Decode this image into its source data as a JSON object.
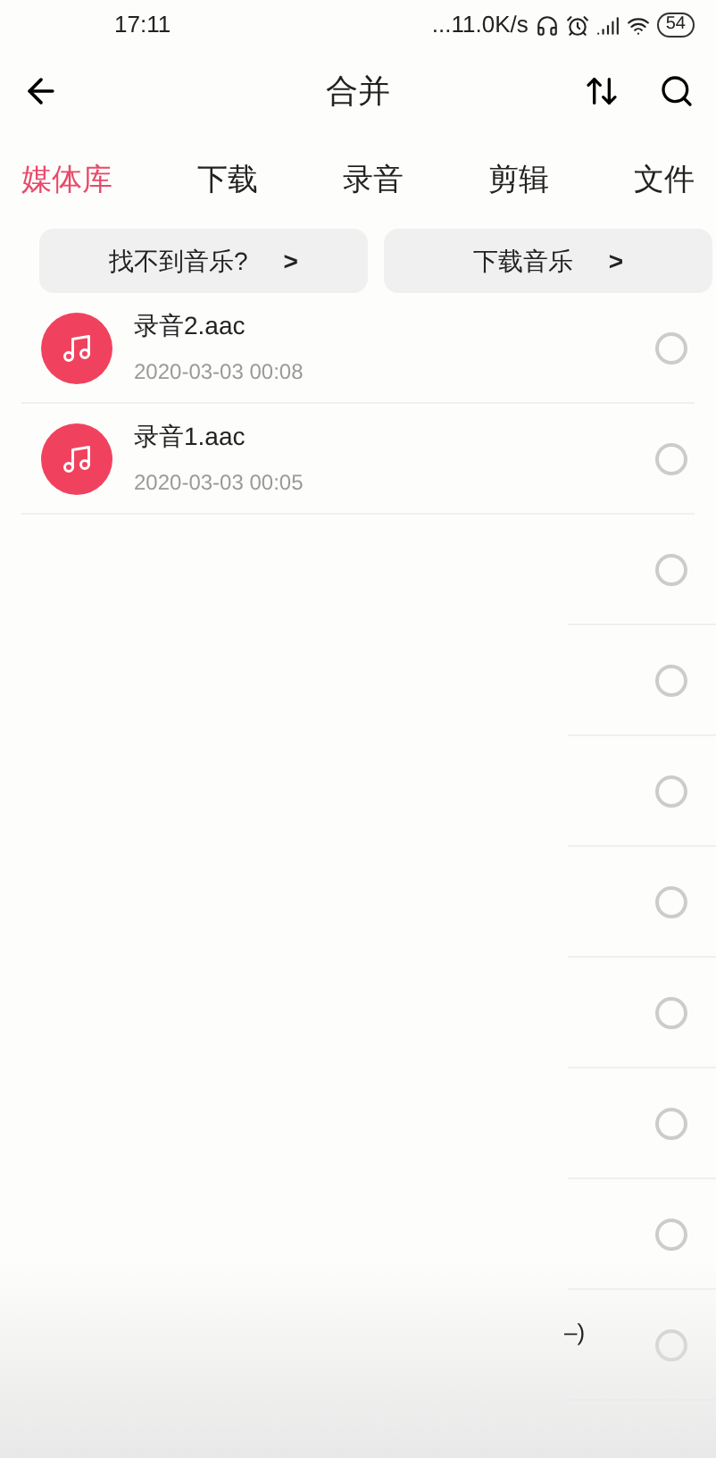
{
  "status_bar": {
    "time": "17:11",
    "speed": "...11.0K/s",
    "battery": "54"
  },
  "header": {
    "title": "合并"
  },
  "tabs": [
    {
      "label": "媒体库",
      "selected": true
    },
    {
      "label": "下载",
      "selected": false
    },
    {
      "label": "录音",
      "selected": false
    },
    {
      "label": "剪辑",
      "selected": false
    },
    {
      "label": "文件",
      "selected": false
    }
  ],
  "links": [
    {
      "label": "找不到音乐?",
      "arrow": ">"
    },
    {
      "label": "下载音乐",
      "arrow": ">"
    }
  ],
  "files": [
    {
      "kind": "file",
      "name": "录音2.aac",
      "meta": "2020-03-03  00:08",
      "selected": false
    },
    {
      "kind": "file",
      "name": "录音1.aac",
      "meta": "2020-03-03  00:05",
      "selected": false
    },
    {
      "kind": "blank",
      "selected": false
    },
    {
      "kind": "blank",
      "selected": false
    },
    {
      "kind": "blank",
      "selected": false
    },
    {
      "kind": "blank",
      "selected": false
    },
    {
      "kind": "blank",
      "selected": false
    },
    {
      "kind": "blank",
      "selected": false
    },
    {
      "kind": "blank",
      "selected": false
    },
    {
      "kind": "blank",
      "selected": false
    }
  ],
  "fragment": "–)"
}
